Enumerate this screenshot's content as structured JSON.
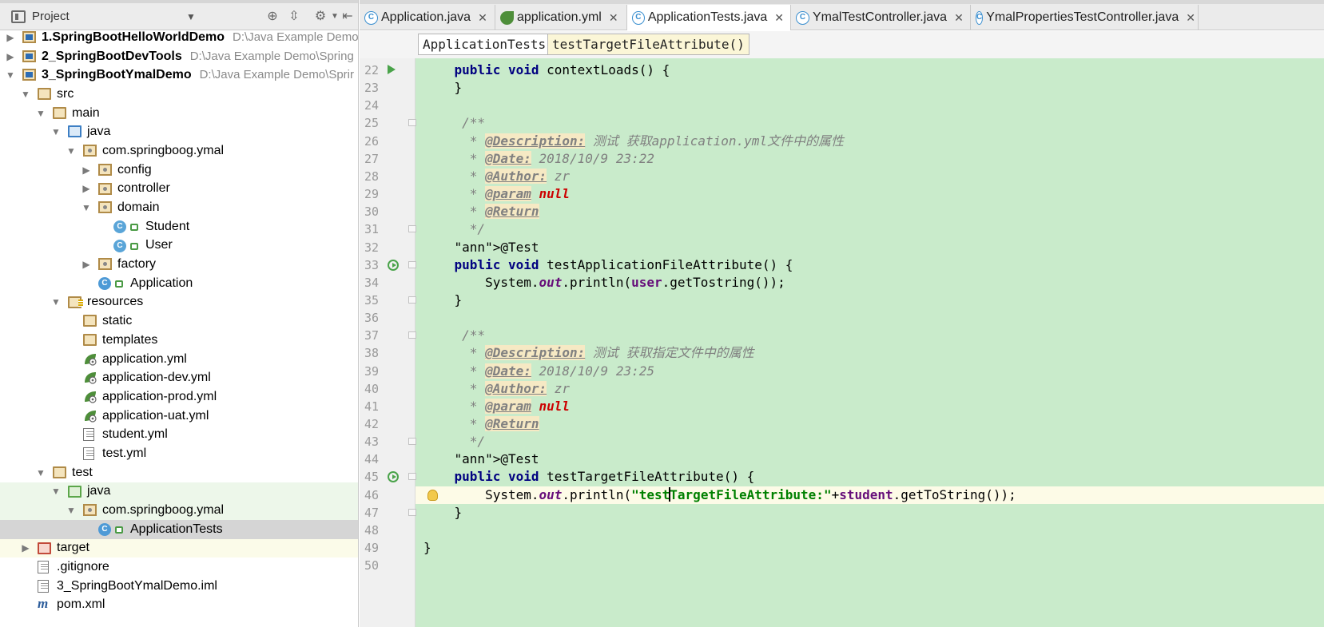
{
  "project": {
    "title": "Project",
    "tree": [
      {
        "name": "1.SpringBootHelloWorldDemo",
        "path": "D:\\Java Example Demo",
        "depth": 0,
        "icon": "module-icon",
        "arrow": "right",
        "bold": true
      },
      {
        "name": "2_SpringBootDevTools",
        "path": "D:\\Java Example Demo\\Spring",
        "depth": 0,
        "icon": "module-icon",
        "arrow": "right",
        "bold": true
      },
      {
        "name": "3_SpringBootYmalDemo",
        "path": "D:\\Java Example Demo\\Sprir",
        "depth": 0,
        "icon": "module-icon",
        "arrow": "down",
        "bold": true
      },
      {
        "name": "src",
        "depth": 1,
        "icon": "folder-icon",
        "arrow": "down"
      },
      {
        "name": "main",
        "depth": 2,
        "icon": "folder-icon",
        "arrow": "down"
      },
      {
        "name": "java",
        "depth": 3,
        "icon": "source-folder-icon",
        "arrow": "down"
      },
      {
        "name": "com.springboog.ymal",
        "depth": 4,
        "icon": "package-icon",
        "arrow": "down"
      },
      {
        "name": "config",
        "depth": 5,
        "icon": "package-icon",
        "arrow": "right"
      },
      {
        "name": "controller",
        "depth": 5,
        "icon": "package-icon",
        "arrow": "right"
      },
      {
        "name": "domain",
        "depth": 5,
        "icon": "package-icon",
        "arrow": "down"
      },
      {
        "name": "Student",
        "depth": 6,
        "icon": "class-icon"
      },
      {
        "name": "User",
        "depth": 6,
        "icon": "class-icon"
      },
      {
        "name": "factory",
        "depth": 5,
        "icon": "package-icon",
        "arrow": "right"
      },
      {
        "name": "Application",
        "depth": 5,
        "icon": "spring-boot-class-icon"
      },
      {
        "name": "resources",
        "depth": 3,
        "icon": "resources-folder-icon",
        "arrow": "down"
      },
      {
        "name": "static",
        "depth": 4,
        "icon": "folder-icon"
      },
      {
        "name": "templates",
        "depth": 4,
        "icon": "folder-icon"
      },
      {
        "name": "application.yml",
        "depth": 4,
        "icon": "spring-yml-icon"
      },
      {
        "name": "application-dev.yml",
        "depth": 4,
        "icon": "spring-yml-icon"
      },
      {
        "name": "application-prod.yml",
        "depth": 4,
        "icon": "spring-yml-icon"
      },
      {
        "name": "application-uat.yml",
        "depth": 4,
        "icon": "spring-yml-icon"
      },
      {
        "name": "student.yml",
        "depth": 4,
        "icon": "yml-file-icon"
      },
      {
        "name": "test.yml",
        "depth": 4,
        "icon": "yml-file-icon"
      },
      {
        "name": "test",
        "depth": 2,
        "icon": "folder-icon",
        "arrow": "down"
      },
      {
        "name": "java",
        "depth": 3,
        "icon": "test-folder-icon",
        "arrow": "down",
        "highlight": "green"
      },
      {
        "name": "com.springboog.ymal",
        "depth": 4,
        "icon": "package-icon",
        "arrow": "down",
        "highlight": "green"
      },
      {
        "name": "ApplicationTests",
        "depth": 5,
        "icon": "test-class-icon",
        "highlight": "selected"
      },
      {
        "name": "target",
        "depth": 1,
        "icon": "excluded-folder-icon",
        "arrow": "right",
        "highlight": "yellow"
      },
      {
        "name": ".gitignore",
        "depth": 1,
        "icon": "text-file-icon"
      },
      {
        "name": "3_SpringBootYmalDemo.iml",
        "depth": 1,
        "icon": "iml-file-icon"
      },
      {
        "name": "pom.xml",
        "depth": 1,
        "icon": "maven-icon"
      }
    ]
  },
  "tabs": [
    {
      "label": "Application.java",
      "icon": "java-class-icon",
      "active": false
    },
    {
      "label": "application.yml",
      "icon": "spring-yml-icon",
      "active": false
    },
    {
      "label": "ApplicationTests.java",
      "icon": "test-class-icon",
      "active": true
    },
    {
      "label": "YmalTestController.java",
      "icon": "java-class-icon",
      "active": false
    },
    {
      "label": "YmalPropertiesTestController.java",
      "icon": "java-class-icon",
      "active": false
    }
  ],
  "breadcrumb": [
    "ApplicationTests",
    "testTargetFileAttribute()"
  ],
  "editor": {
    "caret_line": 46,
    "lines": [
      {
        "n": "22",
        "text": "    public void contextLoads() {"
      },
      {
        "n": "23",
        "text": "    }"
      },
      {
        "n": "24",
        "text": ""
      },
      {
        "n": "25",
        "text": "     /**"
      },
      {
        "n": "26",
        "text": "      * @Description: 测试 获取application.yml文件中的属性"
      },
      {
        "n": "27",
        "text": "      * @Date: 2018/10/9 23:22"
      },
      {
        "n": "28",
        "text": "      * @Author: zr"
      },
      {
        "n": "29",
        "text": "      * @param null"
      },
      {
        "n": "30",
        "text": "      * @Return"
      },
      {
        "n": "31",
        "text": "      */"
      },
      {
        "n": "32",
        "text": "    @Test"
      },
      {
        "n": "33",
        "text": "    public void testApplicationFileAttribute() {"
      },
      {
        "n": "34",
        "text": "        System.out.println(user.getTostring());"
      },
      {
        "n": "35",
        "text": "    }"
      },
      {
        "n": "36",
        "text": ""
      },
      {
        "n": "37",
        "text": "     /**"
      },
      {
        "n": "38",
        "text": "      * @Description: 测试 获取指定文件中的属性"
      },
      {
        "n": "39",
        "text": "      * @Date: 2018/10/9 23:25"
      },
      {
        "n": "40",
        "text": "      * @Author: zr"
      },
      {
        "n": "41",
        "text": "      * @param null"
      },
      {
        "n": "42",
        "text": "      * @Return"
      },
      {
        "n": "43",
        "text": "      */"
      },
      {
        "n": "44",
        "text": "    @Test"
      },
      {
        "n": "45",
        "text": "    public void testTargetFileAttribute() {"
      },
      {
        "n": "46",
        "text": "        System.out.println(\"testTargetFileAttribute:\"+student.getToString());"
      },
      {
        "n": "47",
        "text": "    }"
      },
      {
        "n": "48",
        "text": ""
      },
      {
        "n": "49",
        "text": "}"
      },
      {
        "n": "50",
        "text": ""
      }
    ]
  },
  "colors": {
    "code_bg": "#c9ebcb",
    "caret_line_bg": "#fdfbe7",
    "keyword": "#000080",
    "annotation": "#808000",
    "comment": "#808080",
    "string": "#008000",
    "field": "#660e7a",
    "null_keyword": "#cc0000"
  }
}
